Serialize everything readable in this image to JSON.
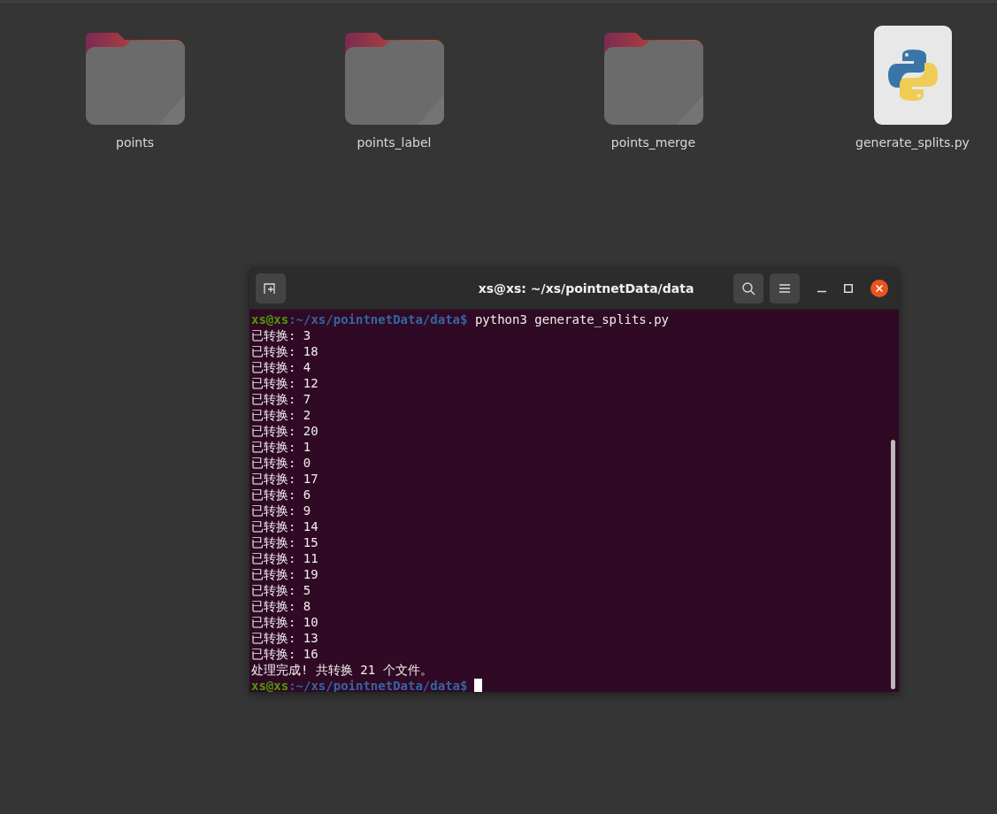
{
  "desktop": {
    "items": [
      {
        "name": "points",
        "kind": "folder"
      },
      {
        "name": "points_label",
        "kind": "folder"
      },
      {
        "name": "points_merge",
        "kind": "folder"
      },
      {
        "name": "generate_splits.py",
        "kind": "python"
      }
    ]
  },
  "terminal": {
    "title": "xs@xs: ~/xs/pointnetData/data",
    "lines": [
      {
        "kind": "prompt",
        "user": "xs@xs",
        "path": ":~/xs/pointnetData/data$",
        "command": "python3 generate_splits.py"
      },
      {
        "kind": "output",
        "text": "已转换: 3"
      },
      {
        "kind": "output",
        "text": "已转换: 18"
      },
      {
        "kind": "output",
        "text": "已转换: 4"
      },
      {
        "kind": "output",
        "text": "已转换: 12"
      },
      {
        "kind": "output",
        "text": "已转换: 7"
      },
      {
        "kind": "output",
        "text": "已转换: 2"
      },
      {
        "kind": "output",
        "text": "已转换: 20"
      },
      {
        "kind": "output",
        "text": "已转换: 1"
      },
      {
        "kind": "output",
        "text": "已转换: 0"
      },
      {
        "kind": "output",
        "text": "已转换: 17"
      },
      {
        "kind": "output",
        "text": "已转换: 6"
      },
      {
        "kind": "output",
        "text": "已转换: 9"
      },
      {
        "kind": "output",
        "text": "已转换: 14"
      },
      {
        "kind": "output",
        "text": "已转换: 15"
      },
      {
        "kind": "output",
        "text": "已转换: 11"
      },
      {
        "kind": "output",
        "text": "已转换: 19"
      },
      {
        "kind": "output",
        "text": "已转换: 5"
      },
      {
        "kind": "output",
        "text": "已转换: 8"
      },
      {
        "kind": "output",
        "text": "已转换: 10"
      },
      {
        "kind": "output",
        "text": "已转换: 13"
      },
      {
        "kind": "output",
        "text": "已转换: 16"
      },
      {
        "kind": "output",
        "text": "处理完成! 共转换 21 个文件。"
      },
      {
        "kind": "prompt",
        "user": "xs@xs",
        "path": ":~/xs/pointnetData/data$",
        "cursor": true
      }
    ]
  }
}
